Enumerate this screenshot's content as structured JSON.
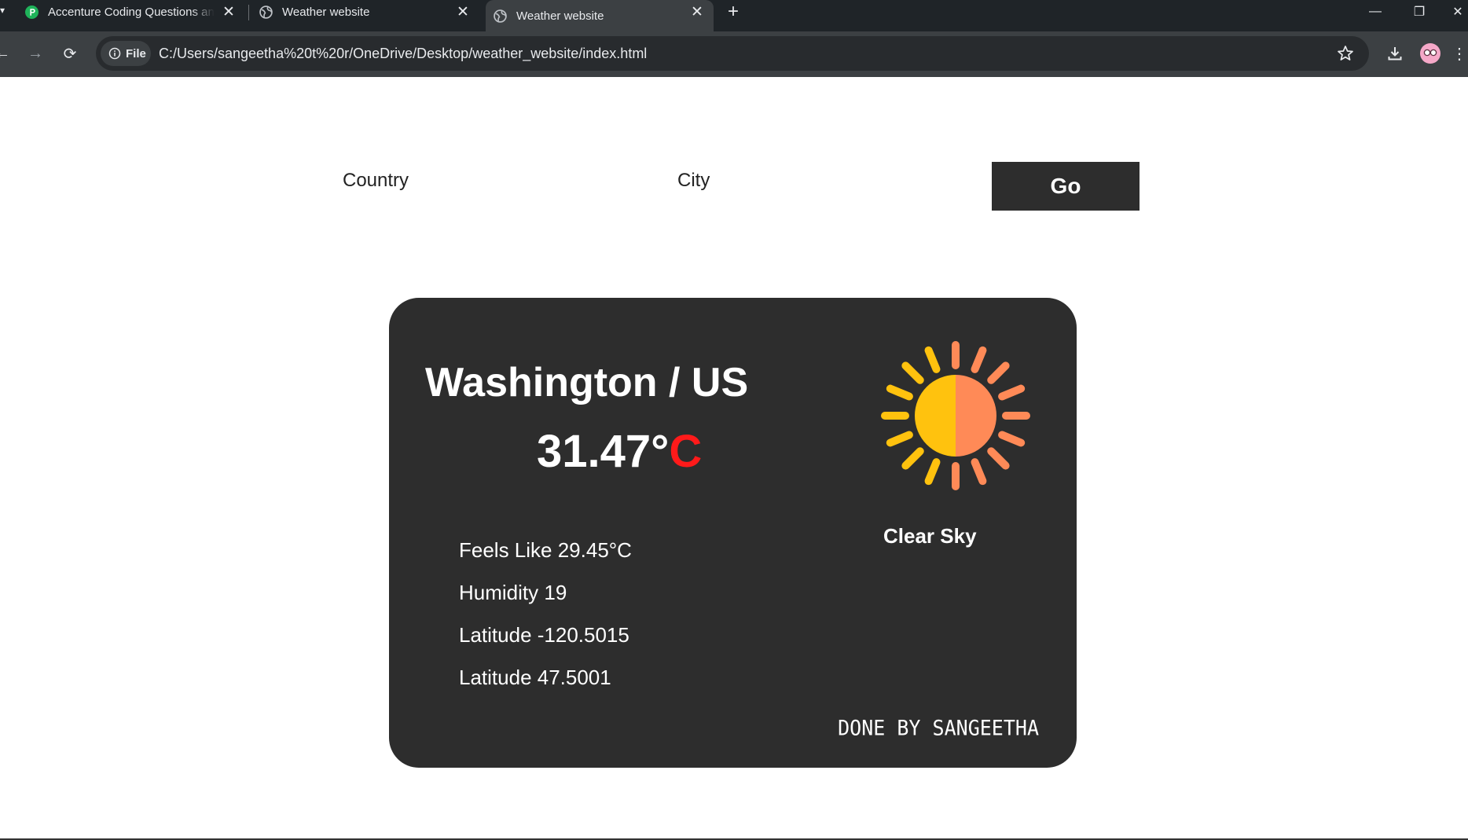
{
  "browser": {
    "tabs": [
      {
        "title": "Accenture Coding Questions and Answers",
        "active": false,
        "favicon": "green-leaf-icon"
      },
      {
        "title": "Weather website",
        "active": false,
        "favicon": "globe-icon"
      },
      {
        "title": "Weather website",
        "active": true,
        "favicon": "globe-icon"
      }
    ],
    "site_chip_label": "File",
    "url": "C:/Users/sangeetha%20t%20r/OneDrive/Desktop/weather_website/index.html"
  },
  "search_form": {
    "country_placeholder": "Country",
    "city_placeholder": "City",
    "go_label": "Go"
  },
  "weather": {
    "location": "Washington / US",
    "temperature_value": "31.47°",
    "temperature_unit": "C",
    "feels_like": "Feels Like 29.45°C",
    "humidity": "Humidity 19",
    "longitude_line": "Latitude -120.5015",
    "latitude_line": "Latitude 47.5001",
    "condition": "Clear Sky",
    "condition_icon": "sun-icon",
    "credit": "DONE BY SANGEETHA"
  },
  "colors": {
    "card_bg": "#2d2d2d",
    "unit_red": "#ff1a1a",
    "sun_yellow": "#ffc20e",
    "sun_orange": "#ff8a57"
  }
}
